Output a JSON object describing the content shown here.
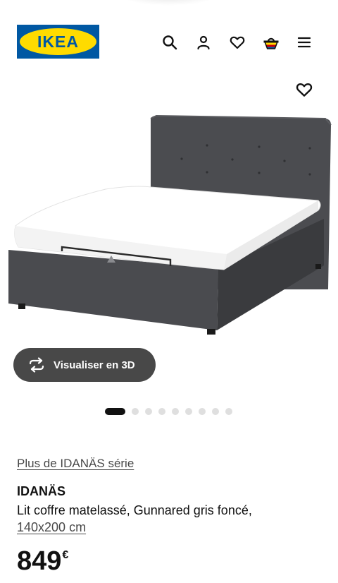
{
  "brand": {
    "logo_text": "IKEA",
    "blue": "#0058A3",
    "yellow": "#FFDB00"
  },
  "header": {
    "icons": [
      "search-icon",
      "user-icon",
      "heart-icon",
      "cart-icon",
      "menu-icon"
    ]
  },
  "gallery": {
    "favorite_icon": "heart-icon",
    "view_3d_label": "Visualiser en 3D",
    "view_3d_icon": "rotate-icon",
    "image_count": 10,
    "active_image": 1
  },
  "product": {
    "series_link": "Plus de IDANÄS série",
    "name": "IDANÄS",
    "description": "Lit coffre matelassé, Gunnared gris foncé,",
    "size": "140x200 cm",
    "price_integer": "849",
    "price_currency": "€"
  }
}
